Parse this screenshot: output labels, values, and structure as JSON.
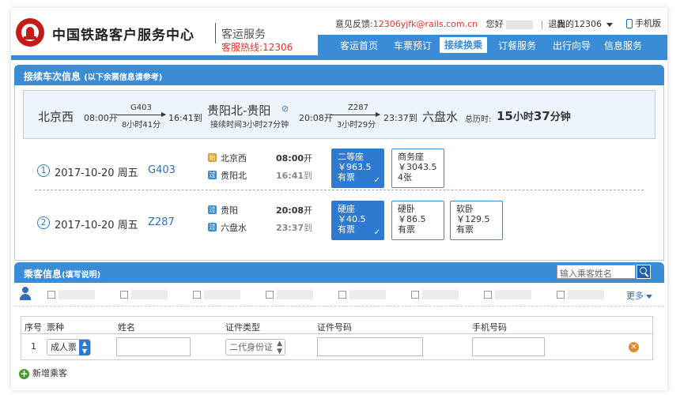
{
  "header": {
    "site_name": "中国铁路客户服务中心",
    "site_sub": "客运服务",
    "hotline": "客服热线:12306",
    "feedback_label": "意见反馈:",
    "feedback_email": "12306yjfk@rails.com.cn",
    "greeting": "您好",
    "logout": "退出",
    "mine": "我的12306",
    "mobile": "手机版"
  },
  "nav": [
    "客运首页",
    "车票预订",
    "接续换乘",
    "订餐服务",
    "出行向导",
    "信息服务"
  ],
  "nav_active_index": 2,
  "transfer_panel": {
    "title": "接续车次信息",
    "note": "(以下余票信息请参考)"
  },
  "summary": {
    "from": "北京西",
    "dep1": "08:00开",
    "train1": "G403",
    "dur1": "8小时41分",
    "arr1": "16:41到",
    "mid": "贵阳北-贵阳",
    "transfer_time": "接续时间3小时27分钟",
    "dep2": "20:08开",
    "train2": "Z287",
    "dur2": "3小时29分",
    "arr2": "23:37到",
    "to": "六盘水",
    "total_label": "总历时:",
    "total_h": "15",
    "total_hu": "小时",
    "total_m": "37",
    "total_mu": "分钟"
  },
  "legs": [
    {
      "num": "1",
      "date": "2017-10-20 周五",
      "train": "G403",
      "from": "北京西",
      "from_icon": "始",
      "to": "贵阳北",
      "to_icon": "过",
      "dep": "08:00",
      "dep_suffix": "开",
      "arr": "16:41",
      "arr_suffix": "到",
      "seats": [
        {
          "name": "二等座",
          "price": "￥963.5",
          "avail": "有票",
          "selected": true
        },
        {
          "name": "商务座",
          "price": "￥3043.5",
          "avail": "4张",
          "selected": false
        }
      ]
    },
    {
      "num": "2",
      "date": "2017-10-20 周五",
      "train": "Z287",
      "from": "贵阳",
      "from_icon": "过",
      "to": "六盘水",
      "to_icon": "过",
      "dep": "20:08",
      "dep_suffix": "开",
      "arr": "23:37",
      "arr_suffix": "到",
      "seats": [
        {
          "name": "硬座",
          "price": "￥40.5",
          "avail": "有票",
          "selected": true
        },
        {
          "name": "硬卧",
          "price": "￥86.5",
          "avail": "有票",
          "selected": false
        },
        {
          "name": "软卧",
          "price": "￥129.5",
          "avail": "有票",
          "selected": false
        }
      ]
    }
  ],
  "passenger_panel": {
    "title": "乘客信息",
    "note": "(填写说明)",
    "search_placeholder": "输入乘客姓名",
    "more": "更多"
  },
  "table": {
    "headers": [
      "序号",
      "票种",
      "姓名",
      "证件类型",
      "证件号码",
      "手机号码"
    ],
    "row": {
      "index": "1",
      "ticket_type": "成人票",
      "id_type": "二代身份证"
    }
  },
  "add_passenger": "新增乘客",
  "colors": {
    "primary": "#3b8cd6",
    "accent": "#e2352a",
    "logo": "#c41a1a"
  }
}
